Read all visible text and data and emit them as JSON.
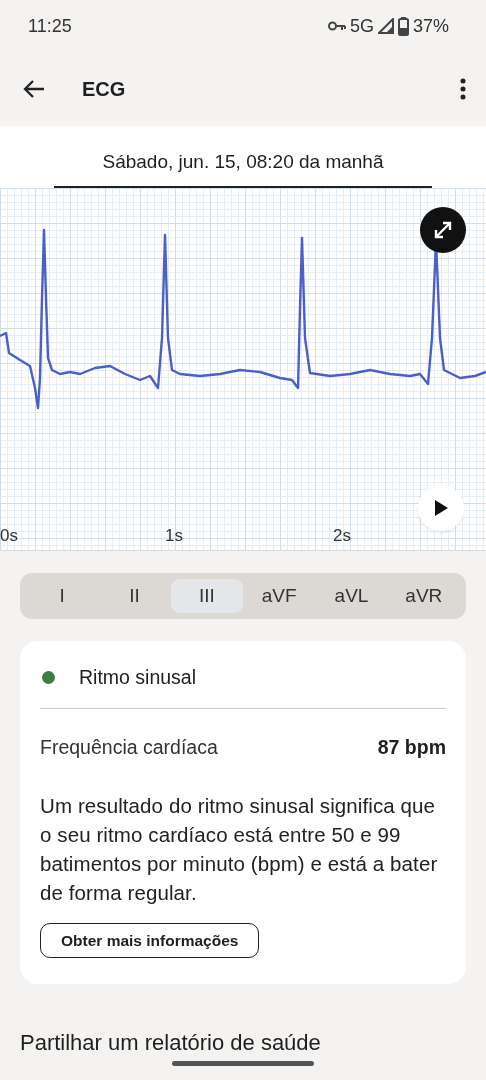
{
  "status_bar": {
    "time": "11:25",
    "network": "5G",
    "battery": "37%"
  },
  "app_bar": {
    "title": "ECG"
  },
  "date_header": {
    "text": "Sábado, jun. 15, 08:20 da manhã"
  },
  "chart": {
    "time_labels": [
      "0s",
      "1s",
      "2s"
    ]
  },
  "leads": [
    {
      "label": "I",
      "selected": false
    },
    {
      "label": "II",
      "selected": false
    },
    {
      "label": "III",
      "selected": true
    },
    {
      "label": "aVF",
      "selected": false
    },
    {
      "label": "aVL",
      "selected": false
    },
    {
      "label": "aVR",
      "selected": false
    }
  ],
  "result": {
    "rhythm": "Ritmo sinusal",
    "color": "#3f7d45",
    "metric_label": "Frequência cardíaca",
    "metric_value": "87 bpm",
    "description": "Um resultado do ritmo sinusal significa que o seu ritmo cardíaco está entre 50 e 99 batimentos por minuto (bpm) e está a bater de forma regular.",
    "button": "Obter mais informações"
  },
  "section_heading": "Partilhar um relatório de saúde"
}
